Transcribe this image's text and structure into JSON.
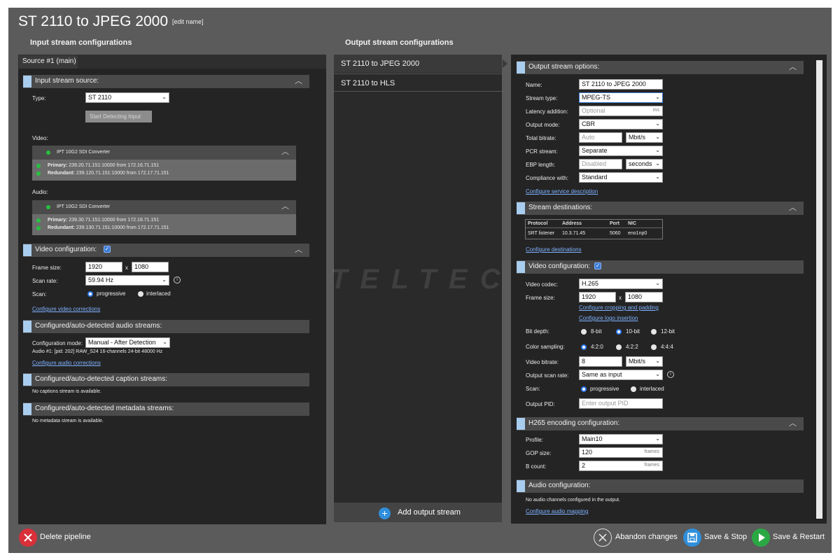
{
  "page": {
    "title": "ST 2110 to JPEG 2000",
    "edit_label": "[edit name]"
  },
  "input": {
    "heading": "Input stream configurations",
    "tab": "Source #1 (main)",
    "source": {
      "section": "Input stream source:",
      "type_label": "Type:",
      "type_value": "ST 2110",
      "detect_button": "Start Detecting Input",
      "video_label": "Video:",
      "video_device": "IPT 10G2 SDI Converter",
      "video_primary_label": "Primary:",
      "video_primary": "239.20.71.151:10000 from 172.16.71.151",
      "video_redundant_label": "Redundant:",
      "video_redundant": "239.120.71.151:10000 from 172.17.71.151",
      "audio_label": "Audio:",
      "audio_device": "IPT 10G2 SDI Converter",
      "audio_primary_label": "Primary:",
      "audio_primary": "239.30.71.151:10000 from 172.16.71.151",
      "audio_redundant_label": "Redundant:",
      "audio_redundant": "239.130.71.151:10000 from 172.17.71.151"
    },
    "video": {
      "section": "Video configuration:",
      "frame_label": "Frame size:",
      "width": "1920",
      "x": "x",
      "height": "1080",
      "rate_label": "Scan rate:",
      "rate": "59.94 Hz",
      "scan_label": "Scan:",
      "progressive": "progressive",
      "interlaced": "interlaced",
      "link": "Configure video corrections"
    },
    "audio": {
      "section": "Configured/auto-detected audio streams:",
      "mode_label": "Configuration mode:",
      "mode": "Manual - After Detection",
      "stream": "Audio #1: [pid: 202] RAW_S24 16-channels 24-bit 48000 Hz",
      "link": "Configure audio corrections"
    },
    "captions": {
      "section": "Configured/auto-detected caption streams:",
      "text": "No captions stream is available."
    },
    "metadata": {
      "section": "Configured/auto-detected metadata streams:",
      "text": "No metadata stream is available."
    }
  },
  "outputs": {
    "heading": "Output stream configurations",
    "items": [
      "ST 2110 to JPEG 2000",
      "ST 2110 to HLS"
    ],
    "add_label": "Add output stream"
  },
  "options": {
    "section": "Output stream options:",
    "name_label": "Name:",
    "name": "ST 2110 to JPEG 2000",
    "type_label": "Stream type:",
    "type": "MPEG-TS",
    "latency_label": "Latency addition:",
    "latency_ph": "Optional",
    "latency_unit": "ms",
    "mode_label": "Output mode:",
    "mode": "CBR",
    "bitrate_label": "Total bitrate:",
    "bitrate_ph": "Auto",
    "bitrate_unit": "Mbit/s",
    "pcr_label": "PCR stream:",
    "pcr": "Separate",
    "ebp_label": "EBP length:",
    "ebp_ph": "Disabled",
    "ebp_unit": "seconds",
    "compliance_label": "Compliance with:",
    "compliance": "Standard",
    "link": "Configure service description"
  },
  "destinations": {
    "section": "Stream destinations:",
    "headers": [
      "Protocol",
      "Address",
      "Port",
      "NIC"
    ],
    "row": [
      "SRT listener",
      "10.3.71.45",
      "5060",
      "eno1np0"
    ],
    "link": "Configure destinations"
  },
  "outvideo": {
    "section": "Video configuration:",
    "codec_label": "Video codec:",
    "codec": "H.265",
    "frame_label": "Frame size:",
    "width": "1920",
    "x": "x",
    "height": "1080",
    "crop_link": "Configure cropping and padding",
    "logo_link": "Configure logo insertion",
    "depth_label": "Bit depth:",
    "d8": "8-bit",
    "d10": "10-bit",
    "d12": "12-bit",
    "sampling_label": "Color sampling:",
    "s420": "4:2:0",
    "s422": "4:2:2",
    "s444": "4:4:4",
    "bitrate_label": "Video bitrate:",
    "bitrate": "8",
    "bitrate_unit": "Mbit/s",
    "scanrate_label": "Output scan rate:",
    "scanrate": "Same as input",
    "scan_label": "Scan:",
    "progressive": "progressive",
    "interlaced": "interlaced",
    "pid_label": "Output PID:",
    "pid_ph": "Enter output PID"
  },
  "h265": {
    "section": "H265 encoding configuration:",
    "profile_label": "Profile:",
    "profile": "Main10",
    "gop_label": "GOP size:",
    "gop": "120",
    "gop_unit": "frames",
    "bcount_label": "B count:",
    "bcount": "2",
    "bcount_unit": "frames"
  },
  "outaudio": {
    "section": "Audio configuration:",
    "text": "No audio channels configured in the output.",
    "link": "Configure audio mapping"
  },
  "footer": {
    "delete": "Delete pipeline",
    "abandon": "Abandon changes",
    "save_stop": "Save & Stop",
    "save_restart": "Save & Restart"
  },
  "watermark": "TELTEC",
  "colors": {
    "accent": "#a9cdee",
    "link": "#7fb2ff",
    "delete": "#d9303a",
    "save": "#2f8fdc",
    "restart": "#2aa843"
  }
}
